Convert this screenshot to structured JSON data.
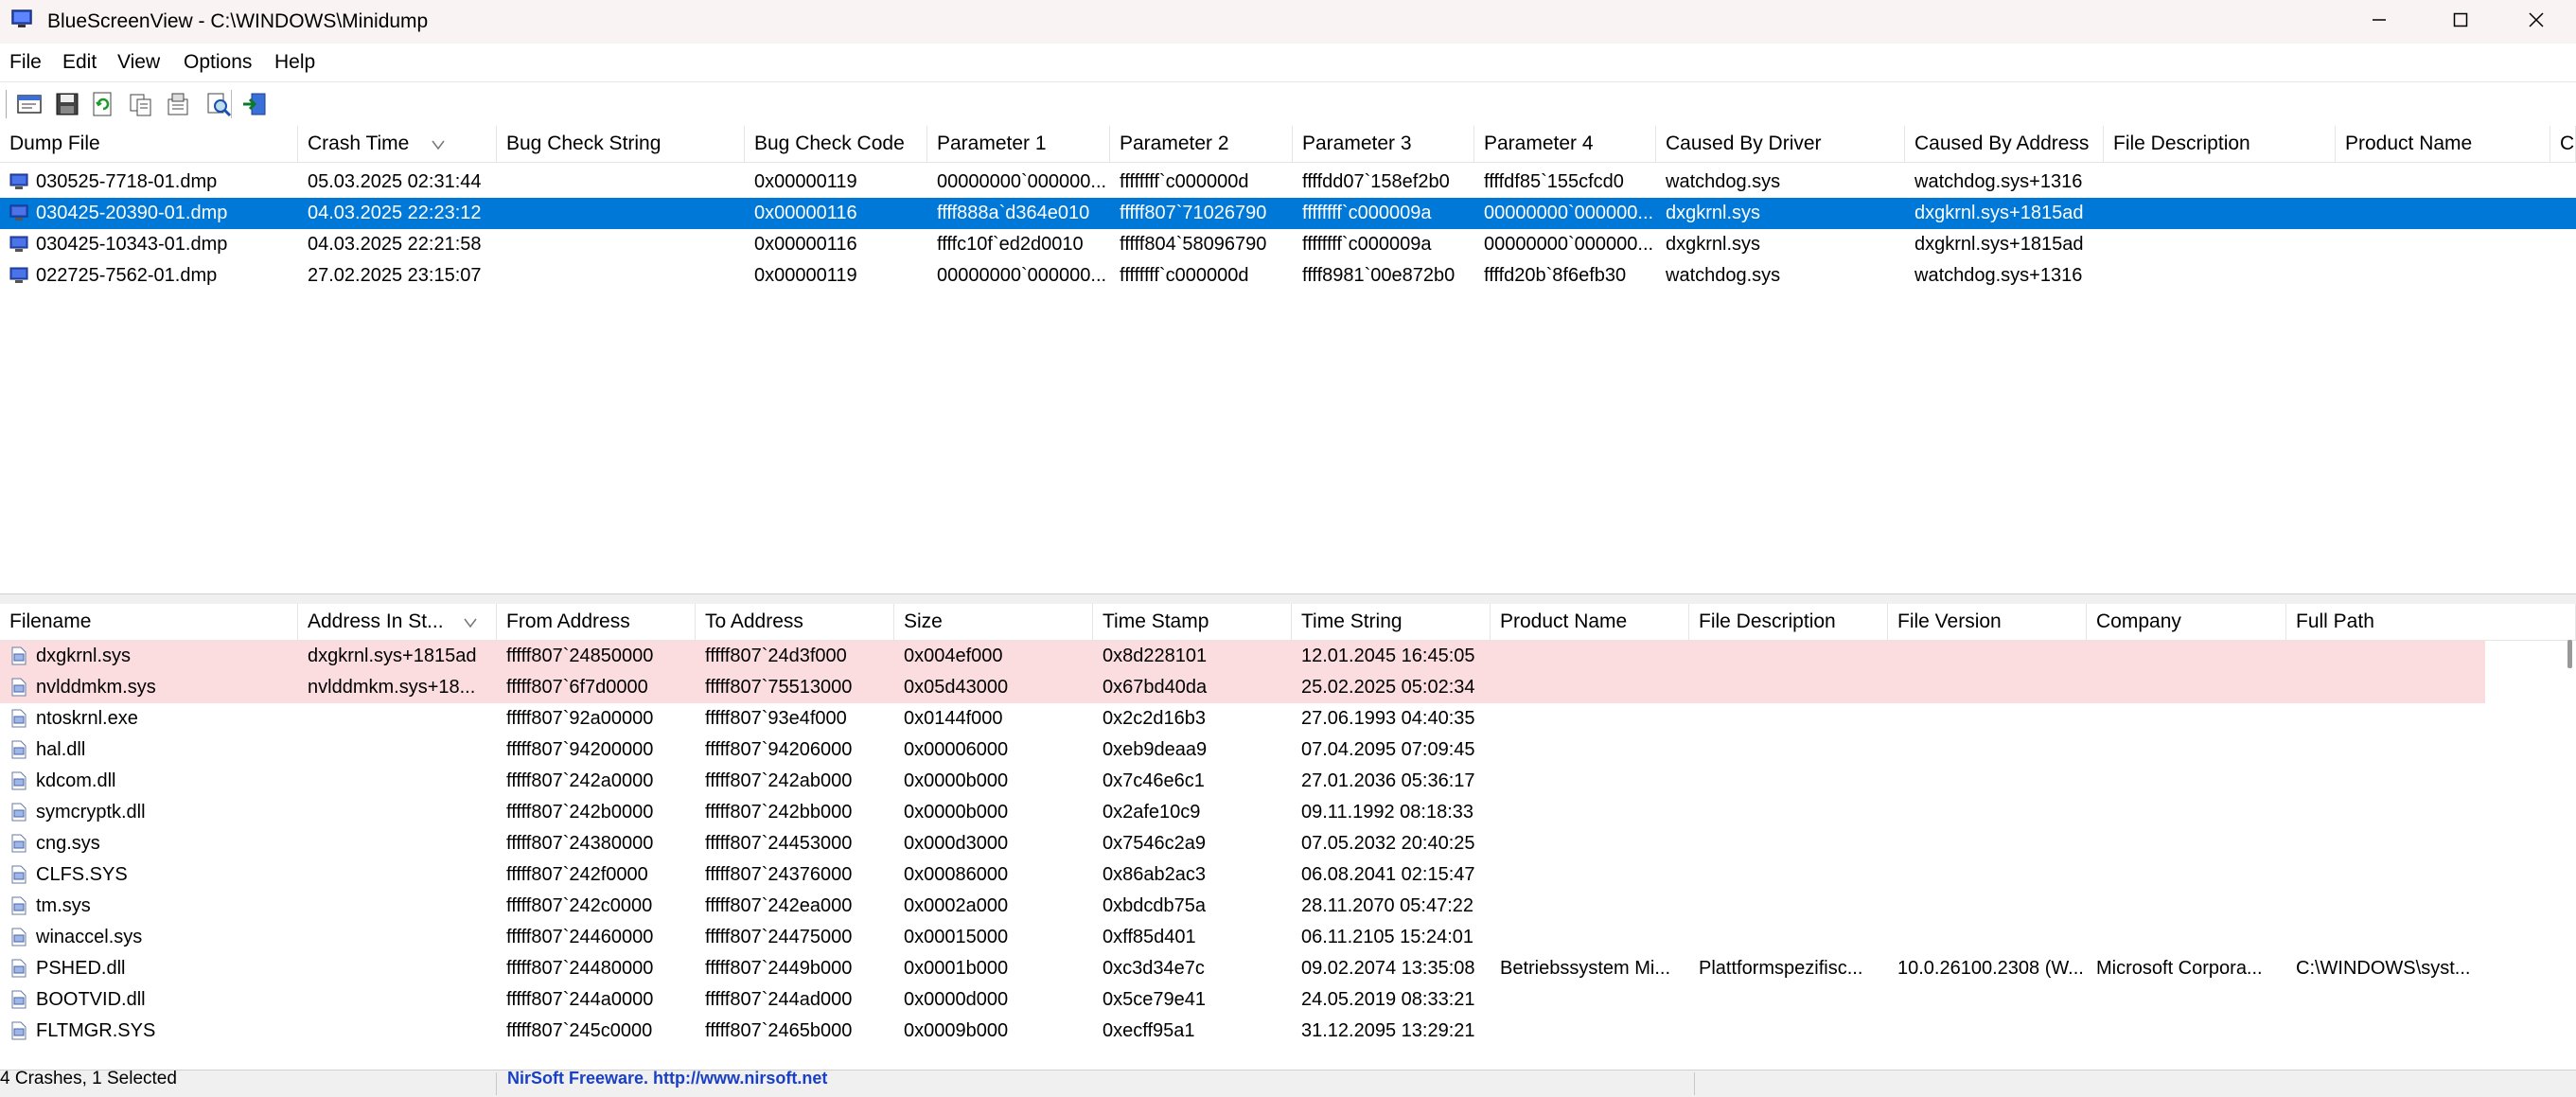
{
  "window": {
    "title": "BlueScreenView  -  C:\\WINDOWS\\Minidump",
    "icons": {
      "app": "monitor-icon",
      "minimize": "minimize-icon",
      "maximize": "maximize-icon",
      "close": "close-icon"
    }
  },
  "menu": [
    "File",
    "Edit",
    "View",
    "Options",
    "Help"
  ],
  "toolbar": [
    "properties-icon",
    "save-icon",
    "refresh-icon",
    "copy-icon",
    "options-icon",
    "find-icon",
    "exit-icon"
  ],
  "colors": {
    "selection": "#0078d7",
    "highlight_row": "#fbdde0"
  },
  "dumps": {
    "columns": [
      "Dump File",
      "Crash Time",
      "Bug Check String",
      "Bug Check Code",
      "Parameter 1",
      "Parameter 2",
      "Parameter 3",
      "Parameter 4",
      "Caused By Driver",
      "Caused By Address",
      "File Description",
      "Product Name",
      "C"
    ],
    "sort_column": 1,
    "selected_index": 1,
    "rows": [
      [
        "030525-7718-01.dmp",
        "05.03.2025 02:31:44",
        "",
        "0x00000119",
        "00000000`000000...",
        "ffffffff`c000000d",
        "ffffdd07`158ef2b0",
        "ffffdf85`155cfcd0",
        "watchdog.sys",
        "watchdog.sys+1316",
        "",
        "",
        ""
      ],
      [
        "030425-20390-01.dmp",
        "04.03.2025 22:23:12",
        "",
        "0x00000116",
        "ffff888a`d364e010",
        "fffff807`71026790",
        "ffffffff`c000009a",
        "00000000`000000...",
        "dxgkrnl.sys",
        "dxgkrnl.sys+1815ad",
        "",
        "",
        ""
      ],
      [
        "030425-10343-01.dmp",
        "04.03.2025 22:21:58",
        "",
        "0x00000116",
        "ffffc10f`ed2d0010",
        "fffff804`58096790",
        "ffffffff`c000009a",
        "00000000`000000...",
        "dxgkrnl.sys",
        "dxgkrnl.sys+1815ad",
        "",
        "",
        ""
      ],
      [
        "022725-7562-01.dmp",
        "27.02.2025 23:15:07",
        "",
        "0x00000119",
        "00000000`000000...",
        "ffffffff`c000000d",
        "ffff8981`00e872b0",
        "ffffd20b`8f6efb30",
        "watchdog.sys",
        "watchdog.sys+1316",
        "",
        "",
        ""
      ]
    ]
  },
  "modules": {
    "columns": [
      "Filename",
      "Address In St...",
      "From Address",
      "To Address",
      "Size",
      "Time Stamp",
      "Time String",
      "Product Name",
      "File Description",
      "File Version",
      "Company",
      "Full Path"
    ],
    "sort_column": 1,
    "highlighted_count": 2,
    "rows": [
      [
        "dxgkrnl.sys",
        "dxgkrnl.sys+1815ad",
        "fffff807`24850000",
        "fffff807`24d3f000",
        "0x004ef000",
        "0x8d228101",
        "12.01.2045 16:45:05",
        "",
        "",
        "",
        "",
        ""
      ],
      [
        "nvlddmkm.sys",
        "nvlddmkm.sys+18...",
        "fffff807`6f7d0000",
        "fffff807`75513000",
        "0x05d43000",
        "0x67bd40da",
        "25.02.2025 05:02:34",
        "",
        "",
        "",
        "",
        ""
      ],
      [
        "ntoskrnl.exe",
        "",
        "fffff807`92a00000",
        "fffff807`93e4f000",
        "0x0144f000",
        "0x2c2d16b3",
        "27.06.1993 04:40:35",
        "",
        "",
        "",
        "",
        ""
      ],
      [
        "hal.dll",
        "",
        "fffff807`94200000",
        "fffff807`94206000",
        "0x00006000",
        "0xeb9deaa9",
        "07.04.2095 07:09:45",
        "",
        "",
        "",
        "",
        ""
      ],
      [
        "kdcom.dll",
        "",
        "fffff807`242a0000",
        "fffff807`242ab000",
        "0x0000b000",
        "0x7c46e6c1",
        "27.01.2036 05:36:17",
        "",
        "",
        "",
        "",
        ""
      ],
      [
        "symcryptk.dll",
        "",
        "fffff807`242b0000",
        "fffff807`242bb000",
        "0x0000b000",
        "0x2afe10c9",
        "09.11.1992 08:18:33",
        "",
        "",
        "",
        "",
        ""
      ],
      [
        "cng.sys",
        "",
        "fffff807`24380000",
        "fffff807`24453000",
        "0x000d3000",
        "0x7546c2a9",
        "07.05.2032 20:40:25",
        "",
        "",
        "",
        "",
        ""
      ],
      [
        "CLFS.SYS",
        "",
        "fffff807`242f0000",
        "fffff807`24376000",
        "0x00086000",
        "0x86ab2ac3",
        "06.08.2041 02:15:47",
        "",
        "",
        "",
        "",
        ""
      ],
      [
        "tm.sys",
        "",
        "fffff807`242c0000",
        "fffff807`242ea000",
        "0x0002a000",
        "0xbdcdb75a",
        "28.11.2070 05:47:22",
        "",
        "",
        "",
        "",
        ""
      ],
      [
        "winaccel.sys",
        "",
        "fffff807`24460000",
        "fffff807`24475000",
        "0x00015000",
        "0xff85d401",
        "06.11.2105 15:24:01",
        "",
        "",
        "",
        "",
        ""
      ],
      [
        "PSHED.dll",
        "",
        "fffff807`24480000",
        "fffff807`2449b000",
        "0x0001b000",
        "0xc3d34e7c",
        "09.02.2074 13:35:08",
        "Betriebssystem Mi...",
        "Plattformspezifisc...",
        "10.0.26100.2308 (W...",
        "Microsoft Corpora...",
        "C:\\WINDOWS\\syst..."
      ],
      [
        "BOOTVID.dll",
        "",
        "fffff807`244a0000",
        "fffff807`244ad000",
        "0x0000d000",
        "0x5ce79e41",
        "24.05.2019 08:33:21",
        "",
        "",
        "",
        "",
        ""
      ],
      [
        "FLTMGR.SYS",
        "",
        "fffff807`245c0000",
        "fffff807`2465b000",
        "0x0009b000",
        "0xecff95a1",
        "31.12.2095 13:29:21",
        "",
        "",
        "",
        "",
        ""
      ]
    ]
  },
  "status": {
    "left": "4 Crashes, 1 Selected",
    "center": "NirSoft Freeware.  http://www.nirsoft.net"
  }
}
